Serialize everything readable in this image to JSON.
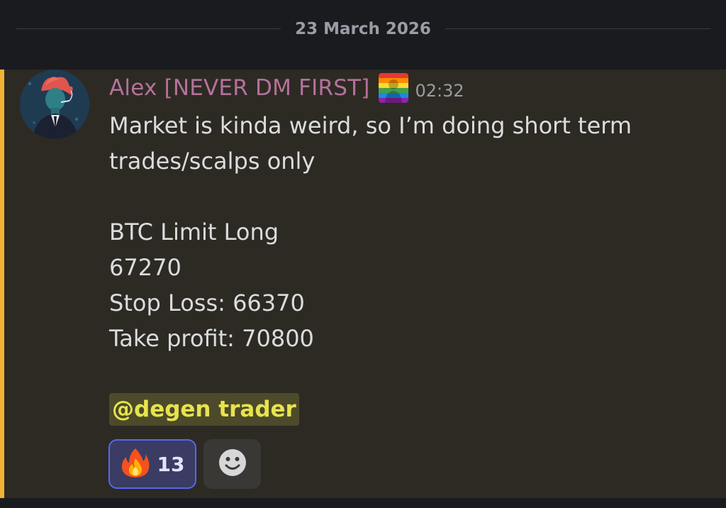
{
  "date_divider": {
    "text": "23 March 2026"
  },
  "message": {
    "author": "Alex [NEVER DM FIRST]",
    "timestamp": "02:32",
    "lines": [
      "Market is kinda weird, so I’m doing short term",
      "trades/scalps only",
      "",
      "BTC Limit Long",
      "67270",
      "Stop Loss: 66370",
      "Take profit: 70800"
    ],
    "mention": "@degen trader",
    "accent_color": "#f0b232",
    "author_color": "#b4729a",
    "mention_color": "#e7e44d"
  },
  "reactions": [
    {
      "icon": "fire-emoji-icon",
      "count": "13"
    },
    {
      "icon": "add-reaction-smiley-icon"
    }
  ]
}
